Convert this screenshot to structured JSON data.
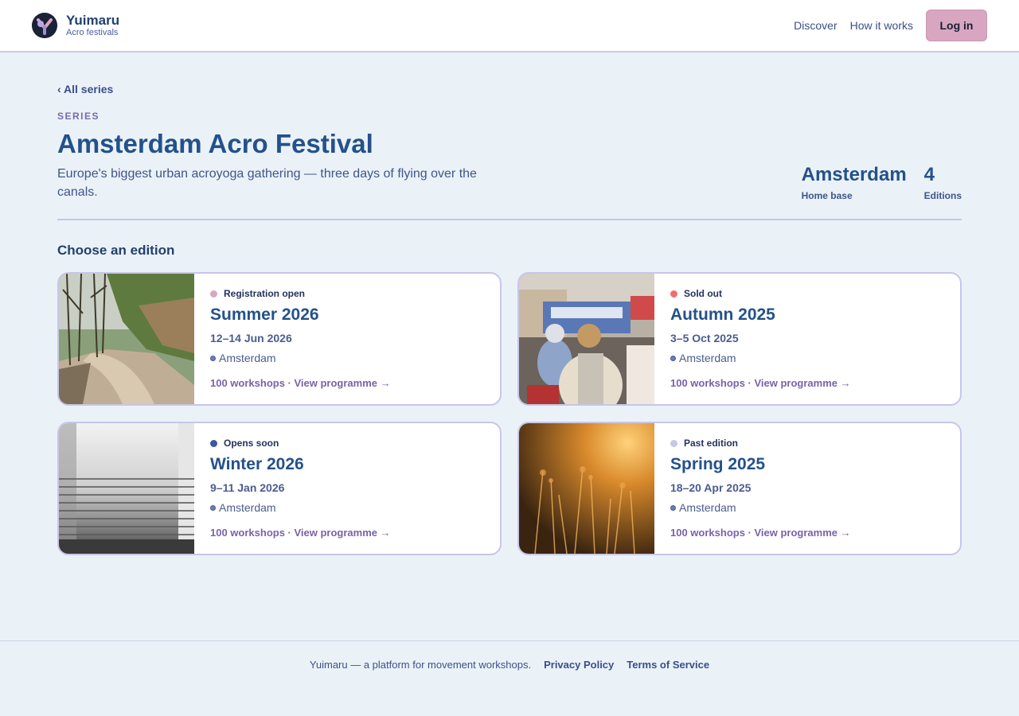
{
  "header": {
    "brand_name": "Yuimaru",
    "brand_sub": "Acro festivals",
    "nav": [
      "Discover",
      "How it works"
    ],
    "login_label": "Log in"
  },
  "page": {
    "back_link": "‹ All series",
    "eyebrow": "SERIES",
    "title": "Amsterdam Acro Festival",
    "description": "Europe's biggest urban acroyoga gathering — three days of flying over the canals.",
    "stats": [
      {
        "value": "Amsterdam",
        "label": "Home base"
      },
      {
        "value": "4",
        "label": "Editions"
      }
    ],
    "section_title": "Choose an edition"
  },
  "editions": [
    {
      "status": "Registration open",
      "status_color": "#d8a6c0",
      "title": "Summer 2026",
      "date": "12–14 Jun 2026",
      "location": "Amsterdam",
      "link": "100 workshops · View programme →",
      "image": "forest-path"
    },
    {
      "status": "Sold out",
      "status_color": "#ef6f6c",
      "title": "Autumn 2025",
      "date": "3–5 Oct 2025",
      "location": "Amsterdam",
      "link": "100 workshops · View programme →",
      "image": "city-street"
    },
    {
      "status": "Opens soon",
      "status_color": "#3d57a0",
      "title": "Winter 2026",
      "date": "9–11 Jan 2026",
      "location": "Amsterdam",
      "link": "100 workshops · View programme →",
      "image": "foggy-stairs"
    },
    {
      "status": "Past edition",
      "status_color": "#c8c6e8",
      "title": "Spring 2025",
      "date": "18–20 Apr 2025",
      "location": "Amsterdam",
      "link": "100 workshops · View programme →",
      "image": "golden-field"
    }
  ],
  "footer": {
    "tagline": "Yuimaru — a platform for movement workshops.",
    "links": [
      "Privacy Policy",
      "Terms of Service"
    ]
  }
}
